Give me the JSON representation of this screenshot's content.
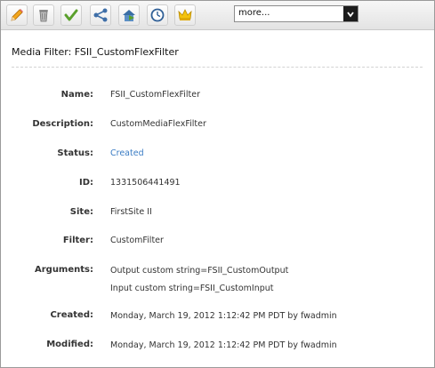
{
  "toolbar": {
    "icons": [
      "edit-pencil-icon",
      "delete-trash-icon",
      "approve-check-icon",
      "share-icon",
      "preview-house-icon",
      "history-clock-icon",
      "crown-icon"
    ],
    "dropdown": {
      "value": "more..."
    }
  },
  "page": {
    "title": "Media Filter: FSII_CustomFlexFilter"
  },
  "details": {
    "name": {
      "label": "Name:",
      "value": "FSII_CustomFlexFilter"
    },
    "description": {
      "label": "Description:",
      "value": "CustomMediaFlexFilter"
    },
    "status": {
      "label": "Status:",
      "value": "Created"
    },
    "id": {
      "label": "ID:",
      "value": "1331506441491"
    },
    "site": {
      "label": "Site:",
      "value": "FirstSite II"
    },
    "filter": {
      "label": "Filter:",
      "value": "CustomFilter"
    },
    "arguments": {
      "label": "Arguments:",
      "values": [
        "Output custom string=FSII_CustomOutput",
        "Input custom string=FSII_CustomInput"
      ]
    },
    "created": {
      "label": "Created:",
      "value": "Monday, March 19, 2012 1:12:42 PM PDT by fwadmin"
    },
    "modified": {
      "label": "Modified:",
      "value": "Monday, March 19, 2012 1:12:42 PM PDT by fwadmin"
    }
  },
  "colors": {
    "link": "#3a7cc4",
    "text": "#333333"
  }
}
